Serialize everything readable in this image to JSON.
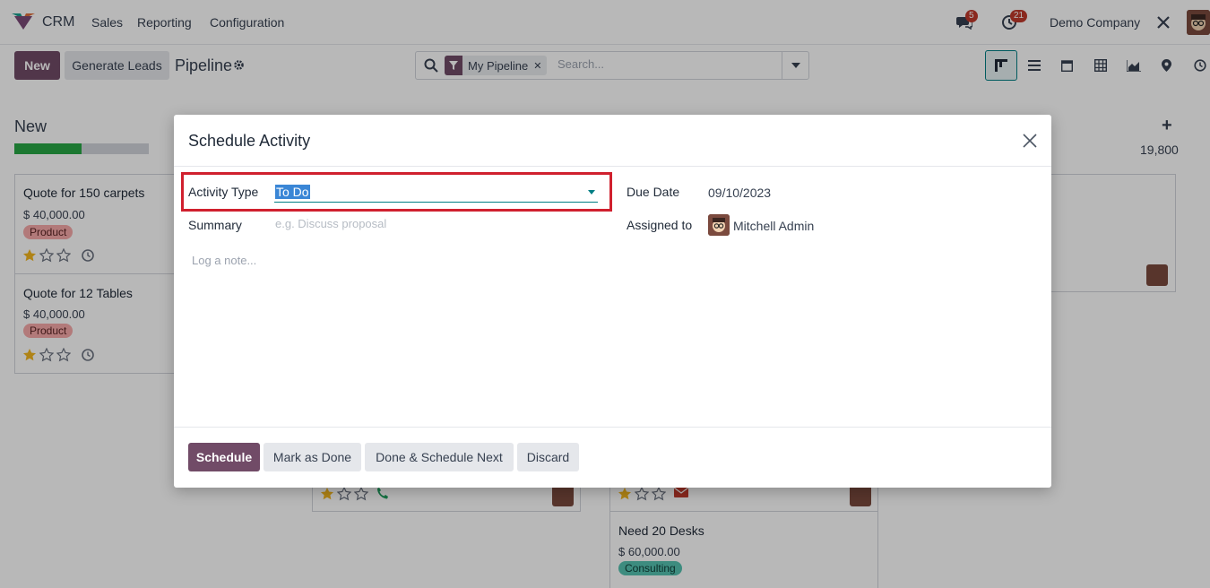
{
  "navbar": {
    "app_name": "CRM",
    "menu": [
      "Sales",
      "Reporting",
      "Configuration"
    ],
    "messages_count": "5",
    "activities_count": "21",
    "company": "Demo Company"
  },
  "control_panel": {
    "new_label": "New",
    "generate_leads_label": "Generate Leads",
    "breadcrumb": "Pipeline",
    "search": {
      "facet": "My Pipeline",
      "placeholder": "Search..."
    }
  },
  "kanban": {
    "column_title": "New",
    "progress_fraction": 0.5,
    "column_total": "19,800",
    "cards": [
      {
        "title": "Quote for 150 carpets",
        "amount": "$ 40,000.00",
        "tag": "Product"
      },
      {
        "title": "Quote for 12 Tables",
        "amount": "$ 40,000.00",
        "tag": "Product"
      },
      {
        "title": "Need 20 Desks",
        "amount": "$ 60,000.00",
        "tag": "Consulting"
      }
    ]
  },
  "modal": {
    "title": "Schedule Activity",
    "activity_type_label": "Activity Type",
    "activity_type_value": "To Do",
    "summary_label": "Summary",
    "summary_placeholder": "e.g. Discuss proposal",
    "note_placeholder": "Log a note...",
    "due_date_label": "Due Date",
    "due_date_value": "09/10/2023",
    "assigned_label": "Assigned to",
    "assigned_value": "Mitchell Admin",
    "buttons": {
      "schedule": "Schedule",
      "mark_done": "Mark as Done",
      "done_next": "Done & Schedule Next",
      "discard": "Discard"
    }
  },
  "colors": {
    "brand": "#714b67",
    "accent": "#017e84",
    "highlight": "#d0202e"
  }
}
